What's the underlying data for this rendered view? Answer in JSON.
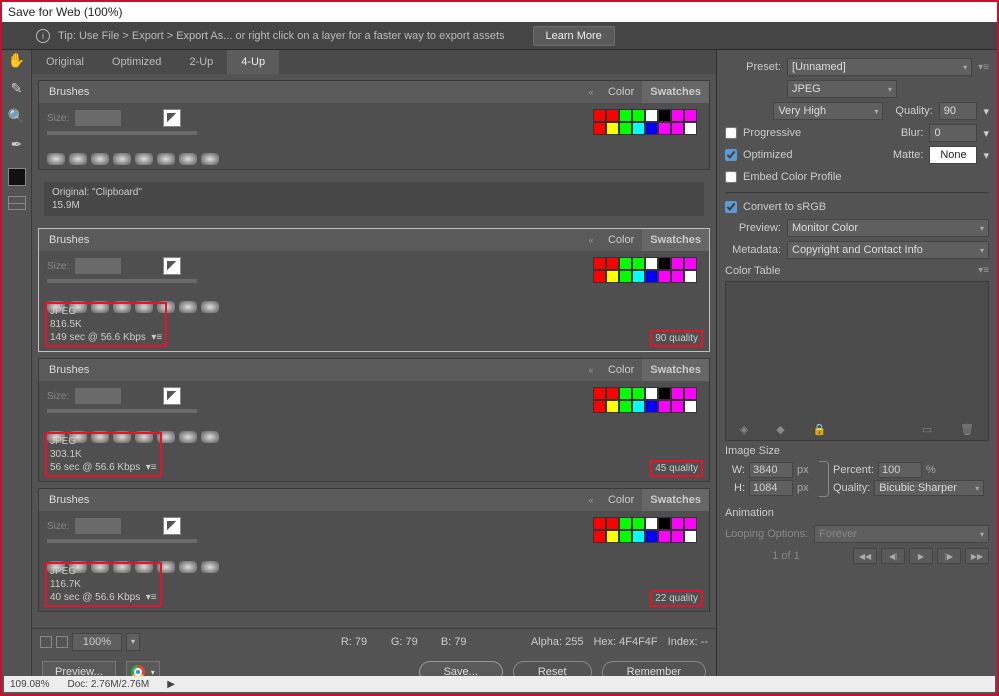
{
  "window_title": "Save for Web (100%)",
  "tip": {
    "text": "Tip: Use File > Export > Export As...  or right click on a layer for a faster way to export assets",
    "learn_more": "Learn More"
  },
  "tabs": {
    "original": "Original",
    "optimized": "Optimized",
    "twoup": "2-Up",
    "fourup": "4-Up"
  },
  "original_strip": {
    "line1": "Original: \"Clipboard\"",
    "line2": "15.9M"
  },
  "pane_labels": {
    "brushes": "Brushes",
    "color": "Color",
    "swatches": "Swatches",
    "size": "Size:"
  },
  "pane1": {
    "format": "JPEG",
    "size": "816.5K",
    "time": "149 sec @ 56.6 Kbps",
    "quality": "90 quality"
  },
  "pane2": {
    "format": "JPEG",
    "size": "303.1K",
    "time": "56 sec @ 56.6 Kbps",
    "quality": "45 quality"
  },
  "pane3": {
    "format": "JPEG",
    "size": "116.7K",
    "time": "40 sec @ 56.6 Kbps",
    "quality": "22 quality"
  },
  "swatches_colors": [
    "#ff0000",
    "#ff0000",
    "#00ff00",
    "#00ff00",
    "#ffffff",
    "#000000",
    "#ff00ff",
    "#ff00ff",
    "#ff0000",
    "#ffff00",
    "#00ff00",
    "#00ffff",
    "#0000ff",
    "#ff00ff",
    "#ff00ff",
    "#ffffff"
  ],
  "readout": {
    "r_lab": "R:",
    "r": "79",
    "g_lab": "G:",
    "g": "79",
    "b_lab": "B:",
    "b": "79",
    "alpha_lab": "Alpha:",
    "alpha": "255",
    "hex_lab": "Hex:",
    "hex": "4F4F4F",
    "index_lab": "Index:",
    "index": "--"
  },
  "zoom": "100%",
  "buttons": {
    "preview": "Preview...",
    "save": "Save...",
    "reset": "Reset",
    "remember": "Remember"
  },
  "preset": {
    "label": "Preset:",
    "value": "[Unnamed]",
    "format": "JPEG",
    "quality_preset": "Very High",
    "quality_lab": "Quality:",
    "quality_val": "90",
    "progressive": "Progressive",
    "blur_lab": "Blur:",
    "blur_val": "0",
    "optimized": "Optimized",
    "matte_lab": "Matte:",
    "matte_val": "None",
    "embed": "Embed Color Profile"
  },
  "convert": {
    "srgb": "Convert to sRGB",
    "preview_lab": "Preview:",
    "preview_val": "Monitor Color",
    "meta_lab": "Metadata:",
    "meta_val": "Copyright and Contact Info"
  },
  "color_table": "Color Table",
  "image_size": {
    "title": "Image Size",
    "w_lab": "W:",
    "w": "3840",
    "h_lab": "H:",
    "h": "1084",
    "px": "px",
    "pct_lab": "Percent:",
    "pct": "100",
    "pct_unit": "%",
    "q_lab": "Quality:",
    "q_val": "Bicubic Sharper"
  },
  "animation": {
    "title": "Animation",
    "loop_lab": "Looping Options:",
    "loop_val": "Forever",
    "frame": "1 of 1"
  },
  "status": {
    "zoom": "109.08%",
    "doc_lab": "Doc:",
    "doc": "2.76M/2.76M"
  }
}
